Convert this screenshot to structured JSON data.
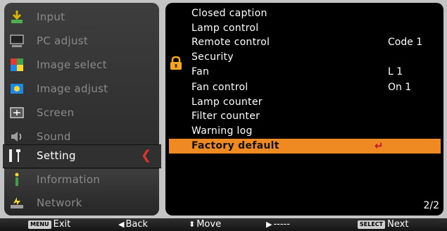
{
  "menu": {
    "items": [
      {
        "label": "Input",
        "icon": "input-icon"
      },
      {
        "label": "PC adjust",
        "icon": "pc-adjust-icon"
      },
      {
        "label": "Image select",
        "icon": "image-select-icon"
      },
      {
        "label": "Image adjust",
        "icon": "image-adjust-icon"
      },
      {
        "label": "Screen",
        "icon": "screen-icon"
      },
      {
        "label": "Sound",
        "icon": "sound-icon"
      },
      {
        "label": "Setting",
        "icon": "setting-icon",
        "selected": true
      },
      {
        "label": "Information",
        "icon": "information-icon"
      },
      {
        "label": "Network",
        "icon": "network-icon"
      }
    ]
  },
  "settings": {
    "rows": [
      {
        "name": "Closed caption",
        "value": ""
      },
      {
        "name": "Lamp control",
        "value": ""
      },
      {
        "name": "Remote control",
        "value": "Code 1"
      },
      {
        "name": "Security",
        "value": "",
        "icon": "lock-icon"
      },
      {
        "name": "Fan",
        "value": "L 1"
      },
      {
        "name": "Fan control",
        "value": "On 1"
      },
      {
        "name": "Lamp counter",
        "value": ""
      },
      {
        "name": "Filter counter",
        "value": ""
      },
      {
        "name": "Warning log",
        "value": ""
      },
      {
        "name": "Factory default",
        "value": "",
        "highlighted": true
      }
    ],
    "page": "2/2"
  },
  "guide": {
    "exit_key": "MENU",
    "exit_label": "Exit",
    "back_label": "Back",
    "move_label": "Move",
    "next_placeholder": "-----",
    "select_key": "SELECT",
    "next_label": "Next"
  },
  "colors": {
    "highlight": "#ef8a22",
    "selected_arrow": "#e0352b",
    "panel": "#000000",
    "menu_bg": "#2e2e2e"
  }
}
